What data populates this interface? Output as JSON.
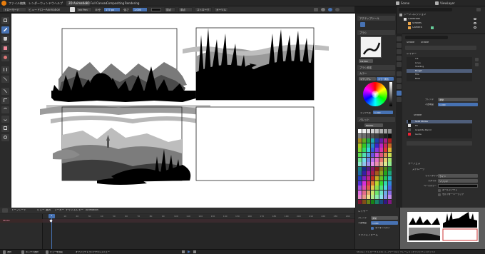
{
  "menubar": {
    "menus": [
      "ファイル",
      "編集",
      "レンダー",
      "ウィンドウ",
      "ヘルプ"
    ],
    "workspaces": [
      "2D Animation",
      "2D Full Canvas",
      "Compositing",
      "Rendering"
    ],
    "scene_label": "Scene",
    "viewlayer_label": "ViewLayer"
  },
  "toolheader": {
    "mode": "ドローモード",
    "menus": [
      "ビュー",
      "ドロー",
      "Animation"
    ],
    "brush": "Ink Pen",
    "radius": "半径",
    "radius_value": "177 px",
    "strength": "強さ",
    "strength_value": "1.000",
    "color_mode": "頂点",
    "stroke_placement": "原点",
    "mode_item": "ストローク",
    "layer_item": "カーソル"
  },
  "toolprops": {
    "tabs": [
      "アクティブツール",
      "ブラシ"
    ],
    "brush_name": "Ink Pen",
    "subpanels": [
      "ブラシ設定",
      "カラー"
    ],
    "color_tabs": [
      "マテリアル",
      "カラー属性"
    ],
    "mix_label": "ミックス比",
    "mix_value": "1.000",
    "palette_title": "パレット",
    "palette_name": "Palette",
    "workspace_panel": "ワークスペース"
  },
  "outliner": {
    "title": "シーンコレクション",
    "items": [
      "Collection",
      "Strokes",
      "Camera",
      "Camera"
    ]
  },
  "properties": {
    "object": "Stroke",
    "data": "Stroke",
    "layers_title": "レイヤー",
    "layers": [
      "Ink",
      "Lines",
      "Shading",
      "Rough",
      "Fills",
      "Base"
    ],
    "blend_label": "ブレンド",
    "blend_value": "通常",
    "opacity_label": "不透明度",
    "opacity_value": "1.000",
    "material_slot_title": "マテリアルスロット",
    "material_name": "Stroke",
    "materials": [
      "Solid Stroke",
      "Fill",
      "Graphite Pencil",
      "Guide"
    ],
    "surface_title": "サーフェス",
    "stroke_title": "ストローク",
    "line_type_label": "ラインタイプ",
    "line_type_value": "ライン",
    "style_label": "スタイル",
    "style_value": "ソリッド",
    "base_color_label": "ベースカラー",
    "holdout_label": "ホールドアウト",
    "self_overlap_label": "セルフオーバーラップ"
  },
  "timeline": {
    "header_items": [
      "ドープシート",
      "ビュー",
      "選択",
      "マーカー",
      "チャンネル",
      "キー",
      "Animation"
    ],
    "channel": "Stroke",
    "frames": [
      "0",
      "10",
      "20",
      "30",
      "40",
      "50",
      "60",
      "70",
      "80",
      "90",
      "100",
      "110",
      "120",
      "130",
      "140",
      "150",
      "160",
      "170",
      "180",
      "190",
      "200",
      "210",
      "220",
      "230",
      "240",
      "250"
    ],
    "current_frame": "1",
    "side_title": "レイヤー",
    "side_blend_label": "ブレンド",
    "side_blend_value": "通常",
    "side_opacity_label": "不透明度",
    "side_opacity_value": "1.000",
    "onion_label": "オニオンスキン",
    "transform_label": "トランスフォーム"
  },
  "statusbar": {
    "items": [
      "選択",
      "ボックス選択",
      "ビューを回転",
      "オブジェクトコンテクストメニュー"
    ],
    "right_text": "Stroke | ストローク:2,241 | レイヤー:Ink | フレーム:1 | オブジェクト:1/3 | 3.0"
  },
  "colors": {
    "accent": "#4772b3",
    "viewport_bg": "#ffffff",
    "panel_bg": "#2b2b2b",
    "playhead": "#4772b3"
  }
}
